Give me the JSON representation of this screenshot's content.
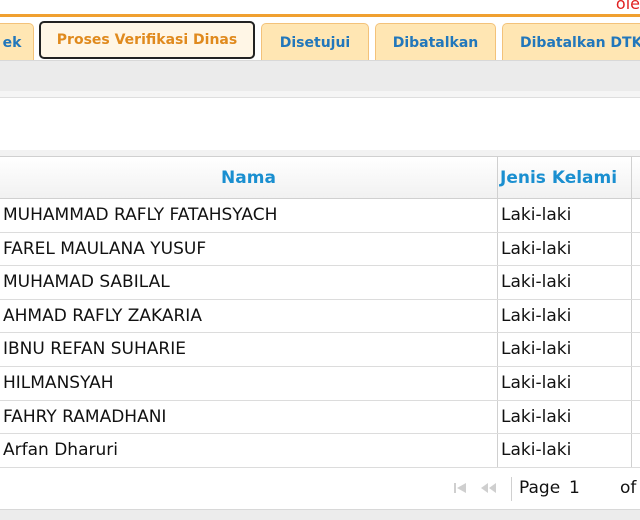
{
  "corner_text": "ole",
  "tabs": [
    {
      "label": "ek",
      "active": false
    },
    {
      "label": "Proses Verifikasi Dinas",
      "active": true
    },
    {
      "label": "Disetujui",
      "active": false
    },
    {
      "label": "Dibatalkan",
      "active": false
    },
    {
      "label": "Dibatalkan DTK",
      "active": false
    }
  ],
  "grid": {
    "headers": {
      "nama": "Nama",
      "jenis_kelamin": "Jenis Kelami"
    },
    "rows": [
      {
        "nama": "MUHAMMAD RAFLY FATAHSYACH",
        "jk": "Laki-laki"
      },
      {
        "nama": "FAREL MAULANA YUSUF",
        "jk": "Laki-laki"
      },
      {
        "nama": "MUHAMAD SABILAL",
        "jk": "Laki-laki"
      },
      {
        "nama": "AHMAD RAFLY ZAKARIA",
        "jk": "Laki-laki"
      },
      {
        "nama": "IBNU REFAN SUHARIE",
        "jk": "Laki-laki"
      },
      {
        "nama": "HILMANSYAH",
        "jk": "Laki-laki"
      },
      {
        "nama": "FAHRY RAMADHANI",
        "jk": "Laki-laki"
      },
      {
        "nama": "Arfan Dharuri",
        "jk": "Laki-laki"
      }
    ]
  },
  "pager": {
    "first_icon": "first-page-icon",
    "prev_icon": "prev-page-icon",
    "page_label": "Page",
    "page_value": "1",
    "of_label": "of"
  }
}
